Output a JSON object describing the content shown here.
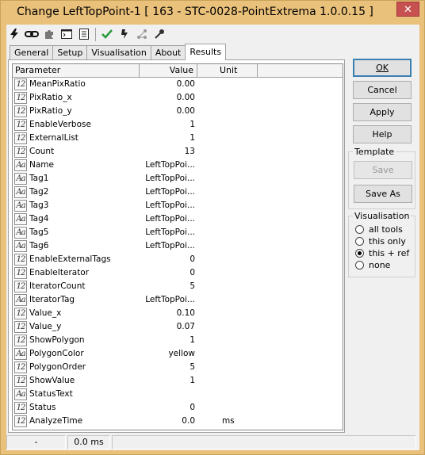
{
  "window": {
    "title": "Change LeftTopPoint-1 [ 163 - STC-0028-PointExtrema 1.0.0.15 ]",
    "close_label": "✕"
  },
  "toolbar": {
    "icons": [
      "lightning-icon",
      "chain-icon",
      "puzzle-icon",
      "console-icon",
      "list-icon",
      "checkmark-icon",
      "teach-icon",
      "network-icon",
      "key-icon"
    ]
  },
  "tabs": [
    {
      "label": "General"
    },
    {
      "label": "Setup"
    },
    {
      "label": "Visualisation"
    },
    {
      "label": "About"
    },
    {
      "label": "Results"
    }
  ],
  "grid": {
    "columns": {
      "parameter": "Parameter",
      "value": "Value",
      "unit": "Unit"
    },
    "rows": [
      {
        "type": "12",
        "name": "MeanPixRatio",
        "value": "0.00",
        "unit": ""
      },
      {
        "type": "12",
        "name": "PixRatio_x",
        "value": "0.00",
        "unit": ""
      },
      {
        "type": "12",
        "name": "PixRatio_y",
        "value": "0.00",
        "unit": ""
      },
      {
        "type": "12",
        "name": "EnableVerbose",
        "value": "1",
        "unit": ""
      },
      {
        "type": "12",
        "name": "ExternalList",
        "value": "1",
        "unit": ""
      },
      {
        "type": "12",
        "name": "Count",
        "value": "13",
        "unit": ""
      },
      {
        "type": "Aa",
        "name": "Name",
        "value": "LeftTopPoi...",
        "unit": ""
      },
      {
        "type": "Aa",
        "name": "Tag1",
        "value": "LeftTopPoi...",
        "unit": ""
      },
      {
        "type": "Aa",
        "name": "Tag2",
        "value": "LeftTopPoi...",
        "unit": ""
      },
      {
        "type": "Aa",
        "name": "Tag3",
        "value": "LeftTopPoi...",
        "unit": ""
      },
      {
        "type": "Aa",
        "name": "Tag4",
        "value": "LeftTopPoi...",
        "unit": ""
      },
      {
        "type": "Aa",
        "name": "Tag5",
        "value": "LeftTopPoi...",
        "unit": ""
      },
      {
        "type": "Aa",
        "name": "Tag6",
        "value": "LeftTopPoi...",
        "unit": ""
      },
      {
        "type": "12",
        "name": "EnableExternalTags",
        "value": "0",
        "unit": ""
      },
      {
        "type": "12",
        "name": "EnableIterator",
        "value": "0",
        "unit": ""
      },
      {
        "type": "12",
        "name": "IteratorCount",
        "value": "5",
        "unit": ""
      },
      {
        "type": "Aa",
        "name": "IteratorTag",
        "value": "LeftTopPoi...",
        "unit": ""
      },
      {
        "type": "12",
        "name": "Value_x",
        "value": "0.10",
        "unit": ""
      },
      {
        "type": "12",
        "name": "Value_y",
        "value": "0.07",
        "unit": ""
      },
      {
        "type": "12",
        "name": "ShowPolygon",
        "value": "1",
        "unit": ""
      },
      {
        "type": "Aa",
        "name": "PolygonColor",
        "value": "yellow",
        "unit": ""
      },
      {
        "type": "12",
        "name": "PolygonOrder",
        "value": "5",
        "unit": ""
      },
      {
        "type": "12",
        "name": "ShowValue",
        "value": "1",
        "unit": ""
      },
      {
        "type": "Aa",
        "name": "StatusText",
        "value": "",
        "unit": ""
      },
      {
        "type": "12",
        "name": "Status",
        "value": "0",
        "unit": ""
      },
      {
        "type": "12",
        "name": "AnalyzeTime",
        "value": "0.0",
        "unit": "ms"
      }
    ]
  },
  "buttons": {
    "ok": "OK",
    "cancel": "Cancel",
    "apply": "Apply",
    "help": "Help"
  },
  "template": {
    "title": "Template",
    "save": "Save",
    "save_as": "Save As"
  },
  "visualisation": {
    "title": "Visualisation",
    "options": [
      {
        "label": "all tools",
        "checked": false
      },
      {
        "label": "this only",
        "checked": false
      },
      {
        "label": "this + ref",
        "checked": true
      },
      {
        "label": "none",
        "checked": false
      }
    ]
  },
  "statusbar": {
    "cell1": "-",
    "cell2": "0.0 ms",
    "cell3": ""
  }
}
